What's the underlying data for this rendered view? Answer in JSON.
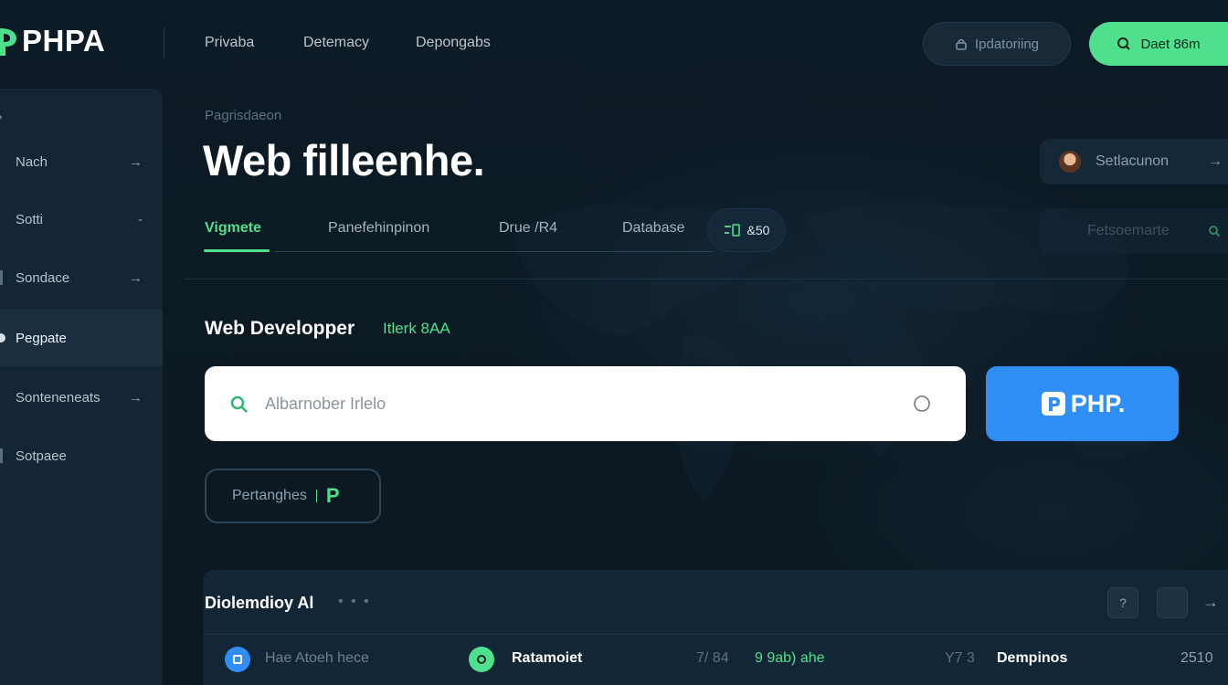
{
  "header": {
    "logo": "PHPA",
    "nav": [
      "Privaba",
      "Detemacy",
      "Depongabs"
    ],
    "outline_button": "Ipdatoriing",
    "green_button": "Daet 86m"
  },
  "sidebar": {
    "items": [
      {
        "label": "Nach",
        "arrow": "→"
      },
      {
        "label": "Sotti",
        "arrow": "-"
      },
      {
        "label": "Sondace",
        "arrow": "→"
      },
      {
        "label": "Pegpate",
        "arrow": ""
      },
      {
        "label": "Sonteneneats",
        "arrow": "→"
      },
      {
        "label": "Sotpaee",
        "arrow": ""
      }
    ]
  },
  "main": {
    "breadcrumb": "Pagrisdaeon",
    "title": "Web filleenhe.",
    "tabs": [
      "Vigmete",
      "Panefehinpinon",
      "Drue /R4",
      "Database"
    ],
    "db_pill": "&50",
    "section_label": "Web Developper",
    "section_tag": "Itlerk 8AA",
    "search_placeholder": "Albarnober Irlelo",
    "php_button": "PHP.",
    "chip_label": "Pertanghes",
    "chip_letter": "P"
  },
  "right_cards": [
    {
      "label": "Setlacunon",
      "arrow": "→"
    },
    {
      "label": "Fetsoemarte",
      "icon": "search-icon"
    }
  ],
  "bottom": {
    "title": "Diolemdioy Al",
    "dots": "• • •",
    "sq_label": "?",
    "arrow": "→",
    "row": {
      "c1": "Hae Atoeh hece",
      "c2": "Ratamoiet",
      "c3": "7/ 84",
      "c4": "9 9ab) ahe",
      "c5": "Y7 3",
      "c6": "Dempinos",
      "c7": "2510"
    }
  },
  "colors": {
    "accent": "#4fe08d",
    "blue": "#2f8ff7",
    "bg": "#0c1a24"
  }
}
